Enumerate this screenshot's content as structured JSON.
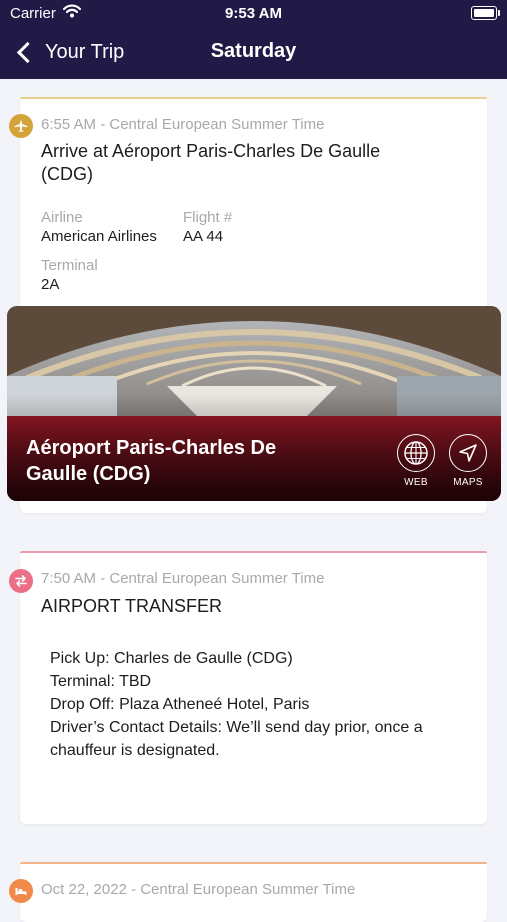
{
  "status_bar": {
    "carrier": "Carrier",
    "time": "9:53 AM"
  },
  "nav": {
    "back_label": "Your Trip",
    "title": "Saturday"
  },
  "colors": {
    "header": "#221a46",
    "flight_accent": "#d4a33a",
    "transfer_accent": "#ea6f87",
    "hotel_accent": "#f08a4b"
  },
  "flight": {
    "icon": "plane-icon",
    "time": "6:55 AM - Central European Summer Time",
    "title_line1": "Arrive at Aéroport Paris-Charles De Gaulle",
    "title_line2": "(CDG)",
    "airline_label": "Airline",
    "airline_value": "American Airlines",
    "flight_label": "Flight #",
    "flight_value": "AA 44",
    "terminal_label": "Terminal",
    "terminal_value": "2A",
    "place_name_line1": "Aéroport Paris-Charles De",
    "place_name_line2": "Gaulle (CDG)",
    "web_label": "WEB",
    "maps_label": "MAPS"
  },
  "transfer": {
    "icon": "transfer-icon",
    "time": "7:50 AM - Central European Summer Time",
    "title": "AIRPORT TRANSFER",
    "details": [
      "Pick Up: Charles de Gaulle (CDG)",
      "Terminal: TBD",
      "Drop Off: Plaza Atheneé Hotel, Paris",
      "Driver’s Contact Details: We’ll send day prior, once a",
      "chauffeur is designated."
    ]
  },
  "hotel": {
    "icon": "bed-icon",
    "time": "Oct 22, 2022 - Central European Summer Time"
  }
}
